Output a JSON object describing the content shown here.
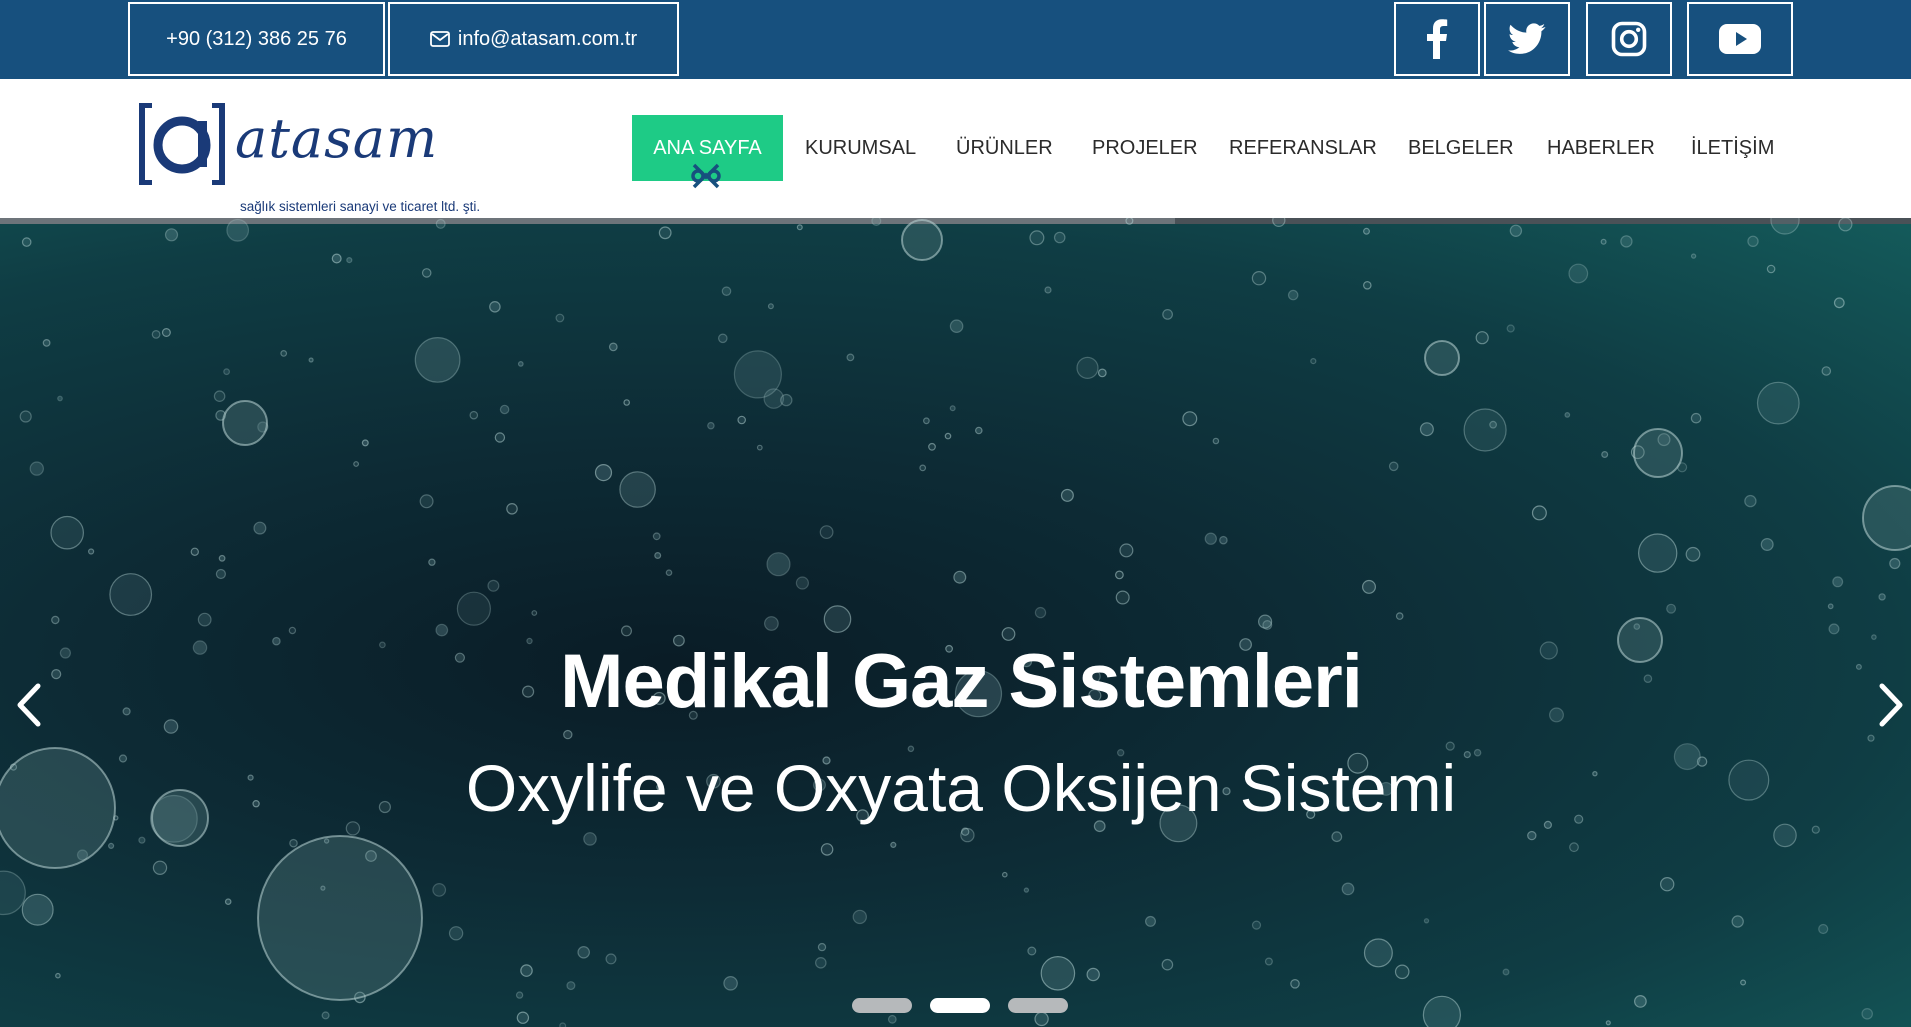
{
  "topbar": {
    "phone": "+90 (312) 386 25 76",
    "email": "info@atasam.com.tr",
    "socials": [
      {
        "name": "facebook",
        "icon": "facebook-icon"
      },
      {
        "name": "twitter",
        "icon": "twitter-icon"
      },
      {
        "name": "instagram",
        "icon": "instagram-icon"
      },
      {
        "name": "youtube",
        "icon": "youtube-icon"
      }
    ],
    "bg_color": "#17507e"
  },
  "logo": {
    "name": "atasam",
    "tagline": "sağlık sistemleri sanayi ve ticaret ltd. şti.",
    "color": "#1a3a78"
  },
  "nav": {
    "items": [
      {
        "label": "ANA SAYFA",
        "active": true
      },
      {
        "label": "KURUMSAL"
      },
      {
        "label": "ÜRÜNLER"
      },
      {
        "label": "PROJELER"
      },
      {
        "label": "REFERANSLAR"
      },
      {
        "label": "BELGELER"
      },
      {
        "label": "HABERLER"
      },
      {
        "label": "İLETİŞİM"
      }
    ],
    "active_color": "#1ecb86"
  },
  "hero": {
    "title": "Medikal Gaz Sistemleri",
    "subtitle": "Oxylife ve Oxyata Oksijen Sistemi",
    "slide_count": 3,
    "active_slide": 2,
    "progress": 0.615
  }
}
